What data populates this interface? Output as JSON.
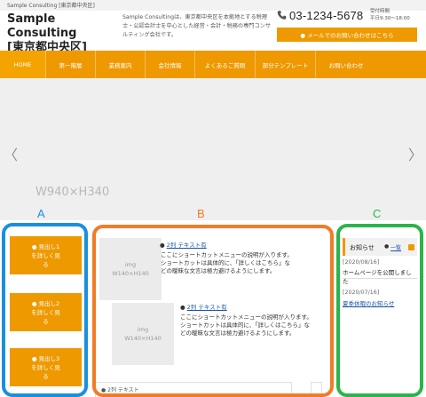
{
  "topbar": {
    "text": "Sample Consulting [東京都中央区]"
  },
  "header": {
    "title_line1": "Sample Consulting",
    "title_line2": "[東京都中央区]",
    "description": "Sample Consultingは、東京都中央区を本拠地とする税理士・公認会計士を中心とした経営・会計・税務の専門コンサルティング会社です。",
    "phone": "03-1234-5678",
    "hours_label": "受付時間",
    "hours_value": "平日9:30〜18:00",
    "contact_button": "● メールでのお問い合わせはこちら"
  },
  "nav": {
    "items": [
      "HOME",
      "第一階層",
      "業務案内",
      "会社情報",
      "よくあるご質問",
      "部分テンプレート",
      "お問い合わせ"
    ]
  },
  "hero": {
    "label": "W940×H340",
    "prev_arrow": "〈",
    "next_arrow": "〉"
  },
  "annotations": {
    "a": "A",
    "b": "B",
    "c": "C",
    "color_a": "#1a8fdd",
    "color_b": "#f07c28",
    "color_c": "#2ab54a"
  },
  "sidebar": {
    "buttons": [
      {
        "line1": "● 見出し1",
        "line2": "を詳しく見",
        "line3": "る"
      },
      {
        "line1": "● 見出し2",
        "line2": "を詳しく見",
        "line3": "る"
      },
      {
        "line1": "● 見出し3",
        "line2": "を詳しく見",
        "line3": "る"
      }
    ]
  },
  "main": {
    "items": [
      {
        "thumb_line1": "img",
        "thumb_line2": "W140×H140",
        "bullet": "●",
        "title": "2列 テキスト有",
        "desc": "ここにショートカットメニューの説明が入ります。ショートカットは具体的に、「詳しくはこちら」などの曖昧な文言は極力避けるようにします。"
      },
      {
        "thumb_line1": "img",
        "thumb_line2": "W140×H140",
        "bullet": "●",
        "title": "2列 テキスト有",
        "desc": "ここにショートカットメニューの説明が入ります。ショートカットは具体的に、「詳しくはこちら」などの曖昧な文言は極力避けるようにします。"
      }
    ],
    "bottom_cut": "● 2列 テキスト"
  },
  "news": {
    "title": "お知らせ",
    "all_dot": "●",
    "all_label": "一覧",
    "entries": [
      {
        "date": "[2020/08/16]",
        "text": "ホームページを公開しました",
        "link": false
      },
      {
        "date": "[2020/07/16]",
        "text": "夏季休暇のお知らせ",
        "link": true
      }
    ]
  }
}
